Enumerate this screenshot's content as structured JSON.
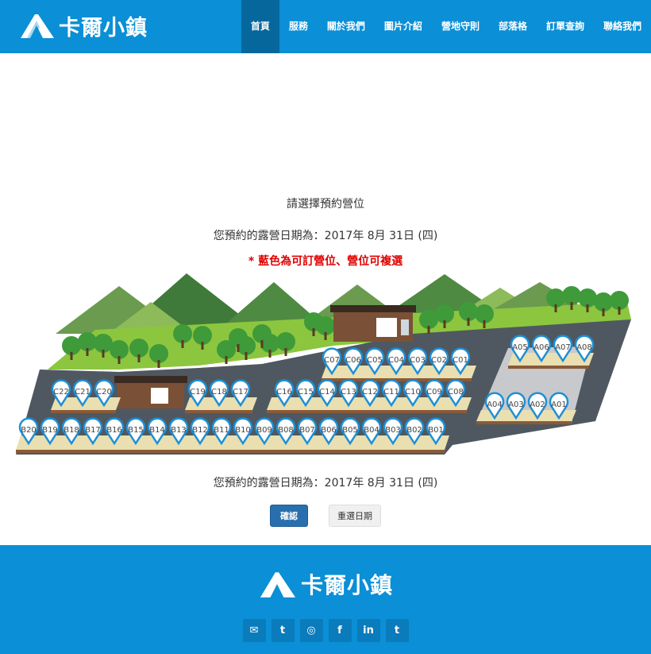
{
  "header": {
    "logo_text": "卡爾小鎮",
    "nav": [
      {
        "label": "首頁",
        "active": true
      },
      {
        "label": "服務"
      },
      {
        "label": "關於我們"
      },
      {
        "label": "圖片介紹"
      },
      {
        "label": "營地守則"
      },
      {
        "label": "部落格"
      },
      {
        "label": "訂單查詢"
      },
      {
        "label": "聯絡我們"
      }
    ]
  },
  "main": {
    "prompt": "請選擇預約營位",
    "date_line": "您預約的露營日期為：2017年 8月 31日 (四)",
    "note": "* 藍色為可訂營位、營位可複選",
    "date_line_bottom": "您預約的露營日期為：2017年 8月 31日 (四)",
    "confirm_label": "確認",
    "reset_label": "重選日期",
    "sites_c_upper": [
      "C07",
      "C06",
      "C05",
      "C04",
      "C03",
      "C02",
      "C01"
    ],
    "sites_c_left": [
      "C22",
      "C21",
      "C20"
    ],
    "sites_c_mid": [
      "C19",
      "C18",
      "C17"
    ],
    "sites_c_lower": [
      "C16",
      "C15",
      "C14",
      "C13",
      "C12",
      "C11",
      "C10",
      "C09",
      "C08"
    ],
    "sites_a_upper": [
      "A05",
      "A06",
      "A07",
      "A08"
    ],
    "sites_a_lower": [
      "A04",
      "A03",
      "A02",
      "A01"
    ],
    "sites_b": [
      "B20",
      "B19",
      "B18",
      "B17",
      "B16",
      "B15",
      "B14",
      "B13",
      "B12",
      "B11",
      "B10",
      "B09",
      "B08",
      "B07",
      "B06",
      "B05",
      "B04",
      "B03",
      "B02",
      "B01"
    ],
    "colors": {
      "available": "#1e8fd6",
      "pin_fill": "#ffffff",
      "road": "#4f5860",
      "grass": "#8cc63f",
      "plot": "#e9dfb0"
    }
  },
  "footer": {
    "logo_text": "卡爾小鎮",
    "social": [
      {
        "icon": "envelope-icon",
        "glyph": "✉"
      },
      {
        "icon": "twitter-icon",
        "glyph": "t"
      },
      {
        "icon": "dribbble-icon",
        "glyph": "◎"
      },
      {
        "icon": "facebook-icon",
        "glyph": "f"
      },
      {
        "icon": "linkedin-icon",
        "glyph": "in"
      },
      {
        "icon": "tumblr-icon",
        "glyph": "t"
      }
    ]
  }
}
